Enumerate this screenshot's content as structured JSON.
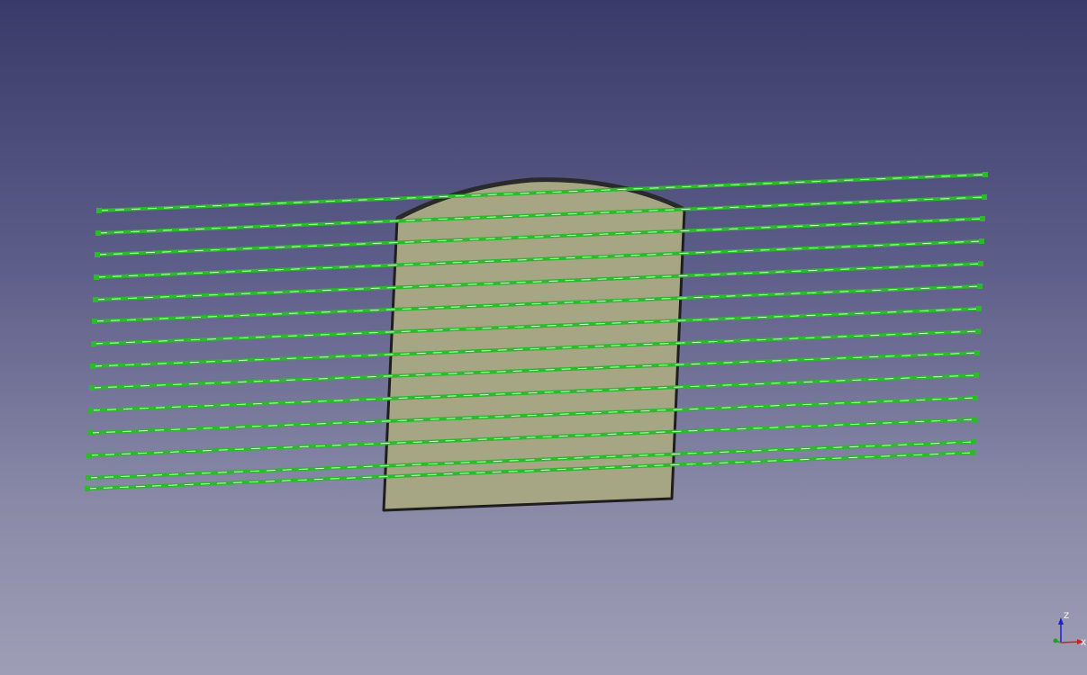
{
  "viewport": {
    "background_top_color": "#3a3a6a",
    "background_bottom_color": "#9e9eb6"
  },
  "model": {
    "face_fill_color": "#a6a684",
    "edge_color": "#1e1e1e",
    "toolpath_color": "#2db82d",
    "toolpath_highlight_color": "#c8ffc8",
    "toolpath_count": 15
  },
  "axis_indicator": {
    "z_label": "Z",
    "x_label": "X",
    "z_color": "#2020d0",
    "x_color": "#d02020",
    "y_color": "#20a020"
  }
}
